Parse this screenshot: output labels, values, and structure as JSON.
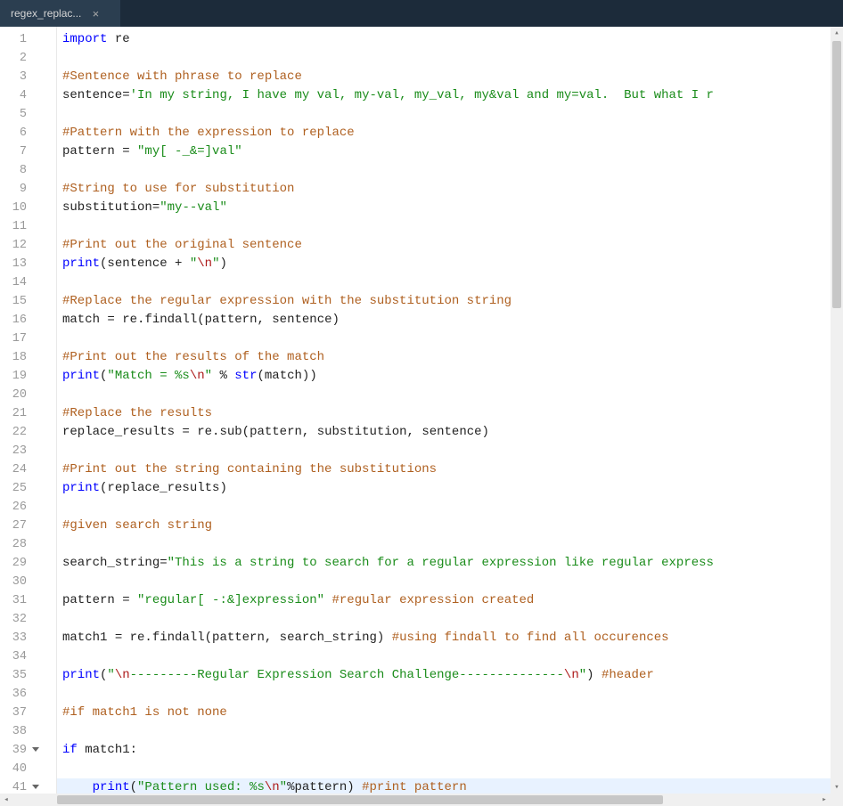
{
  "tab": {
    "name": "regex_replac...",
    "close_glyph": "×"
  },
  "line_count": 41,
  "fold_lines": [
    39,
    41
  ],
  "highlight_line": 41,
  "scroll": {
    "v_up": "▴",
    "v_down": "▾",
    "h_left": "◂",
    "h_right": "▸"
  },
  "lines": [
    {
      "n": 1,
      "tokens": [
        [
          "kw",
          "import"
        ],
        [
          "id",
          " re"
        ]
      ]
    },
    {
      "n": 2,
      "tokens": []
    },
    {
      "n": 3,
      "tokens": [
        [
          "cm",
          "#Sentence with phrase to replace"
        ]
      ]
    },
    {
      "n": 4,
      "tokens": [
        [
          "id",
          "sentence"
        ],
        [
          "op",
          "="
        ],
        [
          "str",
          "'In my string, I have my val, my-val, my_val, my&val and my=val.  But what I r"
        ]
      ]
    },
    {
      "n": 5,
      "tokens": []
    },
    {
      "n": 6,
      "tokens": [
        [
          "cm",
          "#Pattern with the expression to replace"
        ]
      ]
    },
    {
      "n": 7,
      "tokens": [
        [
          "id",
          "pattern "
        ],
        [
          "op",
          "= "
        ],
        [
          "str",
          "\"my[ -_&=]val\""
        ]
      ]
    },
    {
      "n": 8,
      "tokens": []
    },
    {
      "n": 9,
      "tokens": [
        [
          "cm",
          "#String to use for substitution"
        ]
      ]
    },
    {
      "n": 10,
      "tokens": [
        [
          "id",
          "substitution"
        ],
        [
          "op",
          "="
        ],
        [
          "str",
          "\"my--val\""
        ]
      ]
    },
    {
      "n": 11,
      "tokens": []
    },
    {
      "n": 12,
      "tokens": [
        [
          "cm",
          "#Print out the original sentence"
        ]
      ]
    },
    {
      "n": 13,
      "tokens": [
        [
          "fn",
          "print"
        ],
        [
          "op",
          "("
        ],
        [
          "id",
          "sentence "
        ],
        [
          "op",
          "+ "
        ],
        [
          "str",
          "\""
        ],
        [
          "esc",
          "\\n"
        ],
        [
          "str",
          "\""
        ],
        [
          "op",
          ")"
        ]
      ]
    },
    {
      "n": 14,
      "tokens": []
    },
    {
      "n": 15,
      "tokens": [
        [
          "cm",
          "#Replace the regular expression with the substitution string"
        ]
      ]
    },
    {
      "n": 16,
      "tokens": [
        [
          "id",
          "match "
        ],
        [
          "op",
          "= "
        ],
        [
          "id",
          "re.findall"
        ],
        [
          "op",
          "("
        ],
        [
          "id",
          "pattern"
        ],
        [
          "op",
          ", "
        ],
        [
          "id",
          "sentence"
        ],
        [
          "op",
          ")"
        ]
      ]
    },
    {
      "n": 17,
      "tokens": []
    },
    {
      "n": 18,
      "tokens": [
        [
          "cm",
          "#Print out the results of the match"
        ]
      ]
    },
    {
      "n": 19,
      "tokens": [
        [
          "fn",
          "print"
        ],
        [
          "op",
          "("
        ],
        [
          "str",
          "\"Match = %s"
        ],
        [
          "esc",
          "\\n"
        ],
        [
          "str",
          "\""
        ],
        [
          "op",
          " % "
        ],
        [
          "fn",
          "str"
        ],
        [
          "op",
          "("
        ],
        [
          "id",
          "match"
        ],
        [
          "op",
          "))"
        ]
      ]
    },
    {
      "n": 20,
      "tokens": []
    },
    {
      "n": 21,
      "tokens": [
        [
          "cm",
          "#Replace the results"
        ]
      ]
    },
    {
      "n": 22,
      "tokens": [
        [
          "id",
          "replace_results "
        ],
        [
          "op",
          "= "
        ],
        [
          "id",
          "re.sub"
        ],
        [
          "op",
          "("
        ],
        [
          "id",
          "pattern"
        ],
        [
          "op",
          ", "
        ],
        [
          "id",
          "substitution"
        ],
        [
          "op",
          ", "
        ],
        [
          "id",
          "sentence"
        ],
        [
          "op",
          ")"
        ]
      ]
    },
    {
      "n": 23,
      "tokens": []
    },
    {
      "n": 24,
      "tokens": [
        [
          "cm",
          "#Print out the string containing the substitutions"
        ]
      ]
    },
    {
      "n": 25,
      "tokens": [
        [
          "fn",
          "print"
        ],
        [
          "op",
          "("
        ],
        [
          "id",
          "replace_results"
        ],
        [
          "op",
          ")"
        ]
      ]
    },
    {
      "n": 26,
      "tokens": []
    },
    {
      "n": 27,
      "tokens": [
        [
          "cm",
          "#given search string"
        ]
      ]
    },
    {
      "n": 28,
      "tokens": []
    },
    {
      "n": 29,
      "tokens": [
        [
          "id",
          "search_string"
        ],
        [
          "op",
          "="
        ],
        [
          "str",
          "\"This is a string to search for a regular expression like regular express"
        ]
      ]
    },
    {
      "n": 30,
      "tokens": []
    },
    {
      "n": 31,
      "tokens": [
        [
          "id",
          "pattern "
        ],
        [
          "op",
          "= "
        ],
        [
          "str",
          "\"regular[ -:&]expression\""
        ],
        [
          "id",
          " "
        ],
        [
          "cm",
          "#regular expression created"
        ]
      ]
    },
    {
      "n": 32,
      "tokens": []
    },
    {
      "n": 33,
      "tokens": [
        [
          "id",
          "match1 "
        ],
        [
          "op",
          "= "
        ],
        [
          "id",
          "re.findall"
        ],
        [
          "op",
          "("
        ],
        [
          "id",
          "pattern"
        ],
        [
          "op",
          ", "
        ],
        [
          "id",
          "search_string"
        ],
        [
          "op",
          ") "
        ],
        [
          "cm",
          "#using findall to find all occurences"
        ]
      ]
    },
    {
      "n": 34,
      "tokens": []
    },
    {
      "n": 35,
      "tokens": [
        [
          "fn",
          "print"
        ],
        [
          "op",
          "("
        ],
        [
          "str",
          "\""
        ],
        [
          "esc",
          "\\n"
        ],
        [
          "str",
          "---------Regular Expression Search Challenge--------------"
        ],
        [
          "esc",
          "\\n"
        ],
        [
          "str",
          "\""
        ],
        [
          "op",
          ") "
        ],
        [
          "cm",
          "#header"
        ]
      ]
    },
    {
      "n": 36,
      "tokens": []
    },
    {
      "n": 37,
      "tokens": [
        [
          "cm",
          "#if match1 is not none"
        ]
      ]
    },
    {
      "n": 38,
      "tokens": []
    },
    {
      "n": 39,
      "tokens": [
        [
          "kw",
          "if"
        ],
        [
          "id",
          " match1"
        ],
        [
          "op",
          ":"
        ]
      ]
    },
    {
      "n": 40,
      "tokens": []
    },
    {
      "n": 41,
      "tokens": [
        [
          "id",
          "    "
        ],
        [
          "fn",
          "print"
        ],
        [
          "op",
          "("
        ],
        [
          "str",
          "\"Pattern used: %s"
        ],
        [
          "esc",
          "\\n"
        ],
        [
          "str",
          "\""
        ],
        [
          "op",
          "%"
        ],
        [
          "id",
          "pattern"
        ],
        [
          "op",
          ") "
        ],
        [
          "cm",
          "#print pattern"
        ]
      ]
    }
  ]
}
